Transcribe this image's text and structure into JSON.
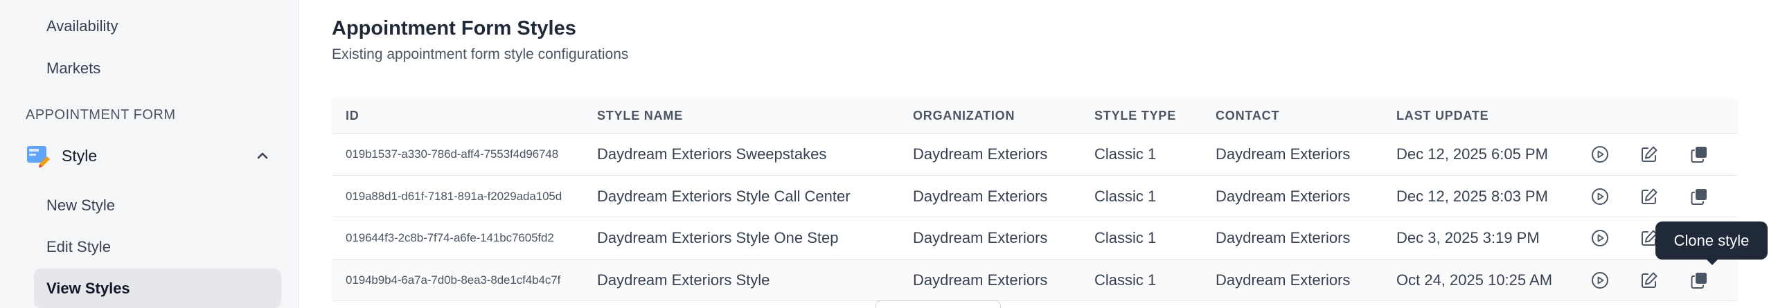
{
  "sidebar": {
    "items_top": [
      "Availability",
      "Markets"
    ],
    "section_label": "APPOINTMENT FORM",
    "group_label": "Style",
    "sub_items": [
      "New Style",
      "Edit Style",
      "View Styles"
    ]
  },
  "page": {
    "title": "Appointment Form Styles",
    "subtitle": "Existing appointment form style configurations"
  },
  "table": {
    "headers": [
      "ID",
      "STYLE NAME",
      "ORGANIZATION",
      "STYLE TYPE",
      "CONTACT",
      "LAST UPDATE"
    ],
    "rows": [
      {
        "id": "019b1537-a330-786d-aff4-7553f4d96748",
        "name": "Daydream Exteriors Sweepstakes",
        "org": "Daydream Exteriors",
        "type": "Classic 1",
        "contact": "Daydream Exteriors",
        "updated": "Dec 12, 2025 6:05 PM"
      },
      {
        "id": "019a88d1-d61f-7181-891a-f2029ada105d",
        "name": "Daydream Exteriors Style Call Center",
        "org": "Daydream Exteriors",
        "type": "Classic 1",
        "contact": "Daydream Exteriors",
        "updated": "Dec 12, 2025 8:03 PM"
      },
      {
        "id": "019644f3-2c8b-7f74-a6fe-141bc7605fd2",
        "name": "Daydream Exteriors Style One Step",
        "org": "Daydream Exteriors",
        "type": "Classic 1",
        "contact": "Daydream Exteriors",
        "updated": "Dec 3, 2025 3:19 PM"
      },
      {
        "id": "0194b9b4-6a7a-7d0b-8ea3-8de1cf4b4c7f",
        "name": "Daydream Exteriors Style",
        "org": "Daydream Exteriors",
        "type": "Classic 1",
        "contact": "Daydream Exteriors",
        "updated": "Oct 24, 2025 10:25 AM"
      }
    ],
    "row_actions": [
      "play-icon",
      "edit-icon",
      "clone-icon"
    ]
  },
  "tooltip": {
    "text": "Clone style"
  },
  "colors": {
    "active_bg": "#e5e7eb",
    "tooltip_bg": "#1f2937",
    "icon": "#4b5563"
  }
}
